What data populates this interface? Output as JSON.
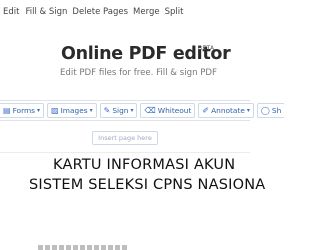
{
  "nav": {
    "items": [
      "Edit",
      "Fill & Sign",
      "Delete Pages",
      "Merge",
      "Split"
    ]
  },
  "hero": {
    "title": "Online PDF editor",
    "badge": "BETA",
    "subtitle": "Edit PDF files for free. Fill & sign PDF"
  },
  "toolbar": {
    "buttons": [
      {
        "label": "Forms",
        "icon": "form-icon",
        "dropdown": true
      },
      {
        "label": "Images",
        "icon": "image-icon",
        "dropdown": true
      },
      {
        "label": "Sign",
        "icon": "pen-icon",
        "dropdown": true
      },
      {
        "label": "Whiteout",
        "icon": "eraser-icon",
        "dropdown": false
      },
      {
        "label": "Annotate",
        "icon": "annotate-icon",
        "dropdown": true
      },
      {
        "label": "Sh",
        "icon": "shapes-icon",
        "dropdown": false
      }
    ]
  },
  "insert_page": {
    "label": "Insert page here"
  },
  "document": {
    "line1": "KARTU INFORMASI AKUN",
    "line2": "SISTEM SELEKSI CPNS NASIONA"
  },
  "colors": {
    "accent": "#2f5fa8",
    "title": "#2b2b2b",
    "subtitle": "#777777"
  }
}
